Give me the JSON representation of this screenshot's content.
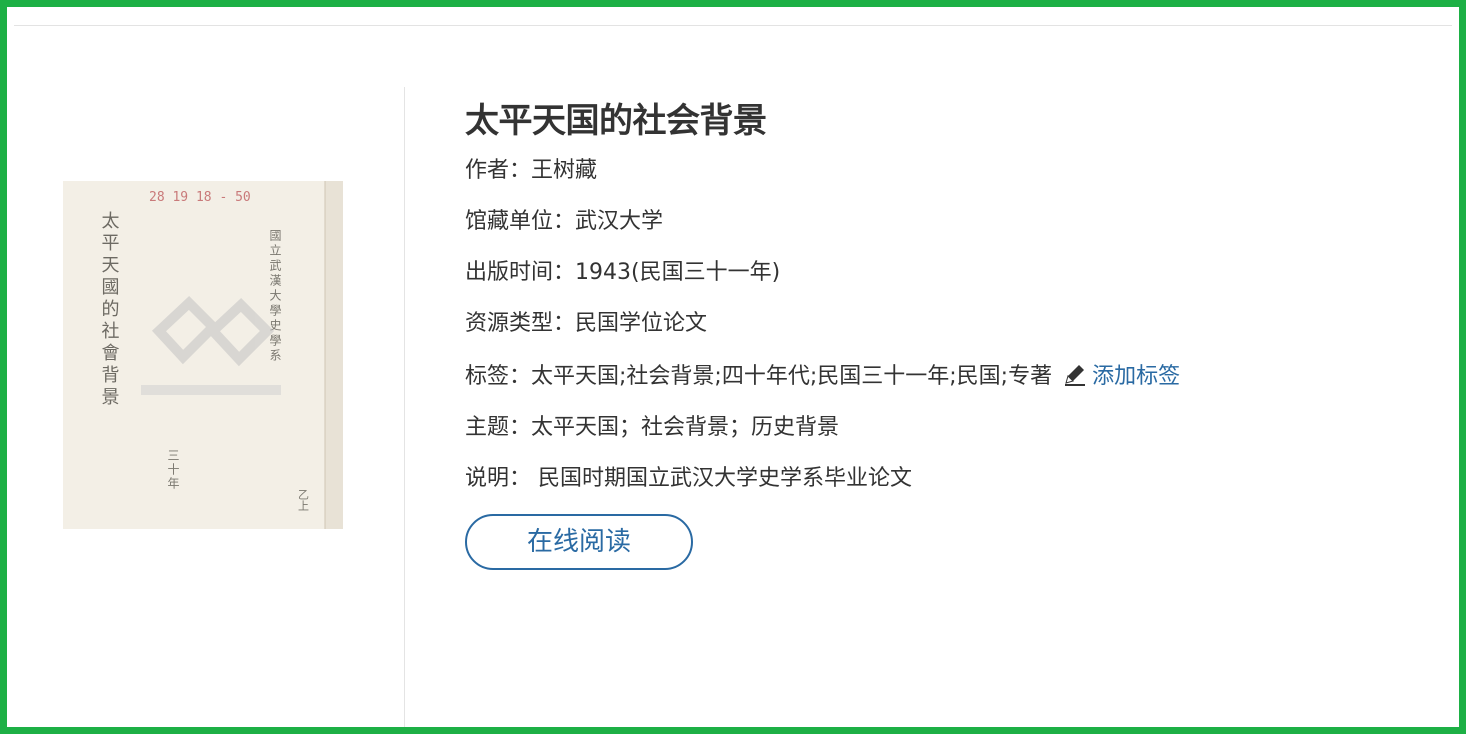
{
  "book": {
    "title": "太平天国的社会背景",
    "author_label": "作者：",
    "author": "王树藏",
    "holding_label": "馆藏单位：",
    "holding": "武汉大学",
    "pubdate_label": "出版时间：",
    "pubdate": "1943(民国三十一年)",
    "type_label": "资源类型：",
    "type": "民国学位论文",
    "tags_label": "标签：",
    "tags": "太平天国;社会背景;四十年代;民国三十一年;民国;专著",
    "add_tag_label": "添加标签",
    "subject_label": "主题：",
    "subject": "太平天国；社会背景；历史背景",
    "note_label": "说明：",
    "note": " 民国时期国立武汉大学史学系毕业论文",
    "read_online_label": "在线阅读"
  },
  "cover": {
    "stamp": "28 19 18 - 50",
    "column_1": "太平天國的社會背景",
    "column_2": "國立武漢大學史學系",
    "column_3": "三十年",
    "column_4": "乙上"
  },
  "colors": {
    "frame_border": "#1db045",
    "text": "#333333",
    "link": "#2a6aa3",
    "cover_bg": "#f3efe6"
  }
}
